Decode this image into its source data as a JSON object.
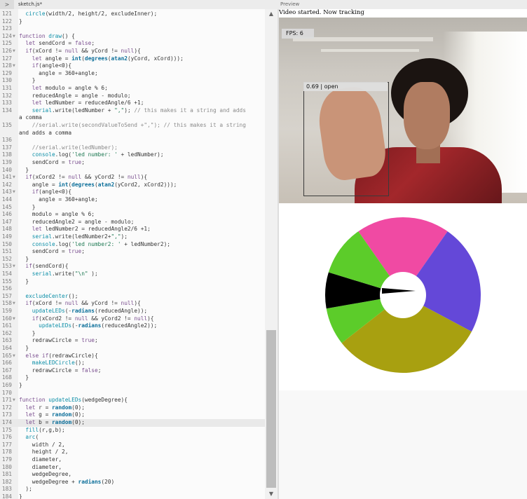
{
  "topbar": {
    "collapse_icon": ">",
    "file_tab": "sketch.js*",
    "preview_tab": "Preview"
  },
  "preview": {
    "status_text": "Video started. Now tracking",
    "fps_label": "FPS: 6",
    "detection_label": "0.69 | open"
  },
  "wheel": {
    "segments": [
      {
        "name": "pink",
        "color": "#f04aa3",
        "start": -35,
        "end": 35
      },
      {
        "name": "purple",
        "color": "#6448d8",
        "start": 35,
        "end": 118
      },
      {
        "name": "olive",
        "color": "#a8a010",
        "start": 118,
        "end": 232
      },
      {
        "name": "green-lower",
        "color": "#5ccc2a",
        "start": 232,
        "end": 260
      },
      {
        "name": "black",
        "color": "#000000",
        "start": 260,
        "end": 287
      },
      {
        "name": "green-upper",
        "color": "#5ccc2a",
        "start": 287,
        "end": 325
      }
    ]
  },
  "editor": {
    "highlighted_line": 174,
    "lines": [
      {
        "n": "121",
        "t": "  circle(width/2, height/2, excludeInner);"
      },
      {
        "n": "122",
        "t": "}"
      },
      {
        "n": "123",
        "t": ""
      },
      {
        "n": "124",
        "t": "function draw() {",
        "fold": true
      },
      {
        "n": "125",
        "t": "  let sendCord = false;"
      },
      {
        "n": "126",
        "t": "  if(xCord != null && yCord != null){",
        "fold": true
      },
      {
        "n": "127",
        "t": "    let angle = int(degrees(atan2(yCord, xCord)));"
      },
      {
        "n": "128",
        "t": "    if(angle<0){",
        "fold": true
      },
      {
        "n": "129",
        "t": "      angle = 360+angle;"
      },
      {
        "n": "130",
        "t": "    }"
      },
      {
        "n": "131",
        "t": "    let modulo = angle % 6;"
      },
      {
        "n": "132",
        "t": "    reducedAngle = angle - modulo;"
      },
      {
        "n": "133",
        "t": "    let ledNumber = reducedAngle/6 +1;"
      },
      {
        "n": "134",
        "t": "    serial.write(ledNumber + \",\"); // this makes it a string and adds"
      },
      {
        "n": "",
        "t": "a comma"
      },
      {
        "n": "135",
        "t": "    //serial.write(secondValueToSend +\",\"); // this makes it a string"
      },
      {
        "n": "",
        "t": "and adds a comma"
      },
      {
        "n": "136",
        "t": ""
      },
      {
        "n": "137",
        "t": "    //serial.write(ledNumber);"
      },
      {
        "n": "138",
        "t": "    console.log('led number: ' + ledNumber);"
      },
      {
        "n": "139",
        "t": "    sendCord = true;"
      },
      {
        "n": "140",
        "t": "  }"
      },
      {
        "n": "141",
        "t": "  if(xCord2 != null && yCord2 != null){",
        "fold": true
      },
      {
        "n": "142",
        "t": "    angle = int(degrees(atan2(yCord2, xCord2)));"
      },
      {
        "n": "143",
        "t": "    if(angle<0){",
        "fold": true
      },
      {
        "n": "144",
        "t": "      angle = 360+angle;"
      },
      {
        "n": "145",
        "t": "    }"
      },
      {
        "n": "146",
        "t": "    modulo = angle % 6;"
      },
      {
        "n": "147",
        "t": "    reducedAngle2 = angle - modulo;"
      },
      {
        "n": "148",
        "t": "    let ledNumber2 = reducedAngle2/6 +1;"
      },
      {
        "n": "149",
        "t": "    serial.write(ledNumber2+\",\");"
      },
      {
        "n": "150",
        "t": "    console.log('led number2: ' + ledNumber2);"
      },
      {
        "n": "151",
        "t": "    sendCord = true;"
      },
      {
        "n": "152",
        "t": "  }"
      },
      {
        "n": "153",
        "t": "  if(sendCord){",
        "fold": true
      },
      {
        "n": "154",
        "t": "    serial.write(\"\\n\" );"
      },
      {
        "n": "155",
        "t": "  }"
      },
      {
        "n": "156",
        "t": ""
      },
      {
        "n": "157",
        "t": "  excludeCenter();"
      },
      {
        "n": "158",
        "t": "  if(xCord != null && yCord != null){",
        "fold": true
      },
      {
        "n": "159",
        "t": "    updateLEDs(-radians(reducedAngle));"
      },
      {
        "n": "160",
        "t": "    if(xCord2 != null && yCord2 != null){",
        "fold": true
      },
      {
        "n": "161",
        "t": "      updateLEDs(-radians(reducedAngle2));"
      },
      {
        "n": "162",
        "t": "    }"
      },
      {
        "n": "163",
        "t": "    redrawCircle = true;"
      },
      {
        "n": "164",
        "t": "  }"
      },
      {
        "n": "165",
        "t": "  else if(redrawCircle){",
        "fold": true
      },
      {
        "n": "166",
        "t": "    makeLEDCircle();"
      },
      {
        "n": "167",
        "t": "    redrawCircle = false;"
      },
      {
        "n": "168",
        "t": "  }"
      },
      {
        "n": "169",
        "t": "}"
      },
      {
        "n": "170",
        "t": ""
      },
      {
        "n": "171",
        "t": "function updateLEDs(wedgeDegree){",
        "fold": true
      },
      {
        "n": "172",
        "t": "  let r = random(0);"
      },
      {
        "n": "173",
        "t": "  let g = random(0);"
      },
      {
        "n": "174",
        "t": "  let b = random(0);"
      },
      {
        "n": "175",
        "t": "  fill(r,g,b);"
      },
      {
        "n": "176",
        "t": "  arc("
      },
      {
        "n": "177",
        "t": "    width / 2,"
      },
      {
        "n": "178",
        "t": "    height / 2,"
      },
      {
        "n": "179",
        "t": "    diameter,"
      },
      {
        "n": "180",
        "t": "    diameter,"
      },
      {
        "n": "181",
        "t": "    wedgeDegree,"
      },
      {
        "n": "182",
        "t": "    wedgeDegree + radians(20)"
      },
      {
        "n": "183",
        "t": "  );"
      },
      {
        "n": "184",
        "t": "}"
      }
    ]
  }
}
